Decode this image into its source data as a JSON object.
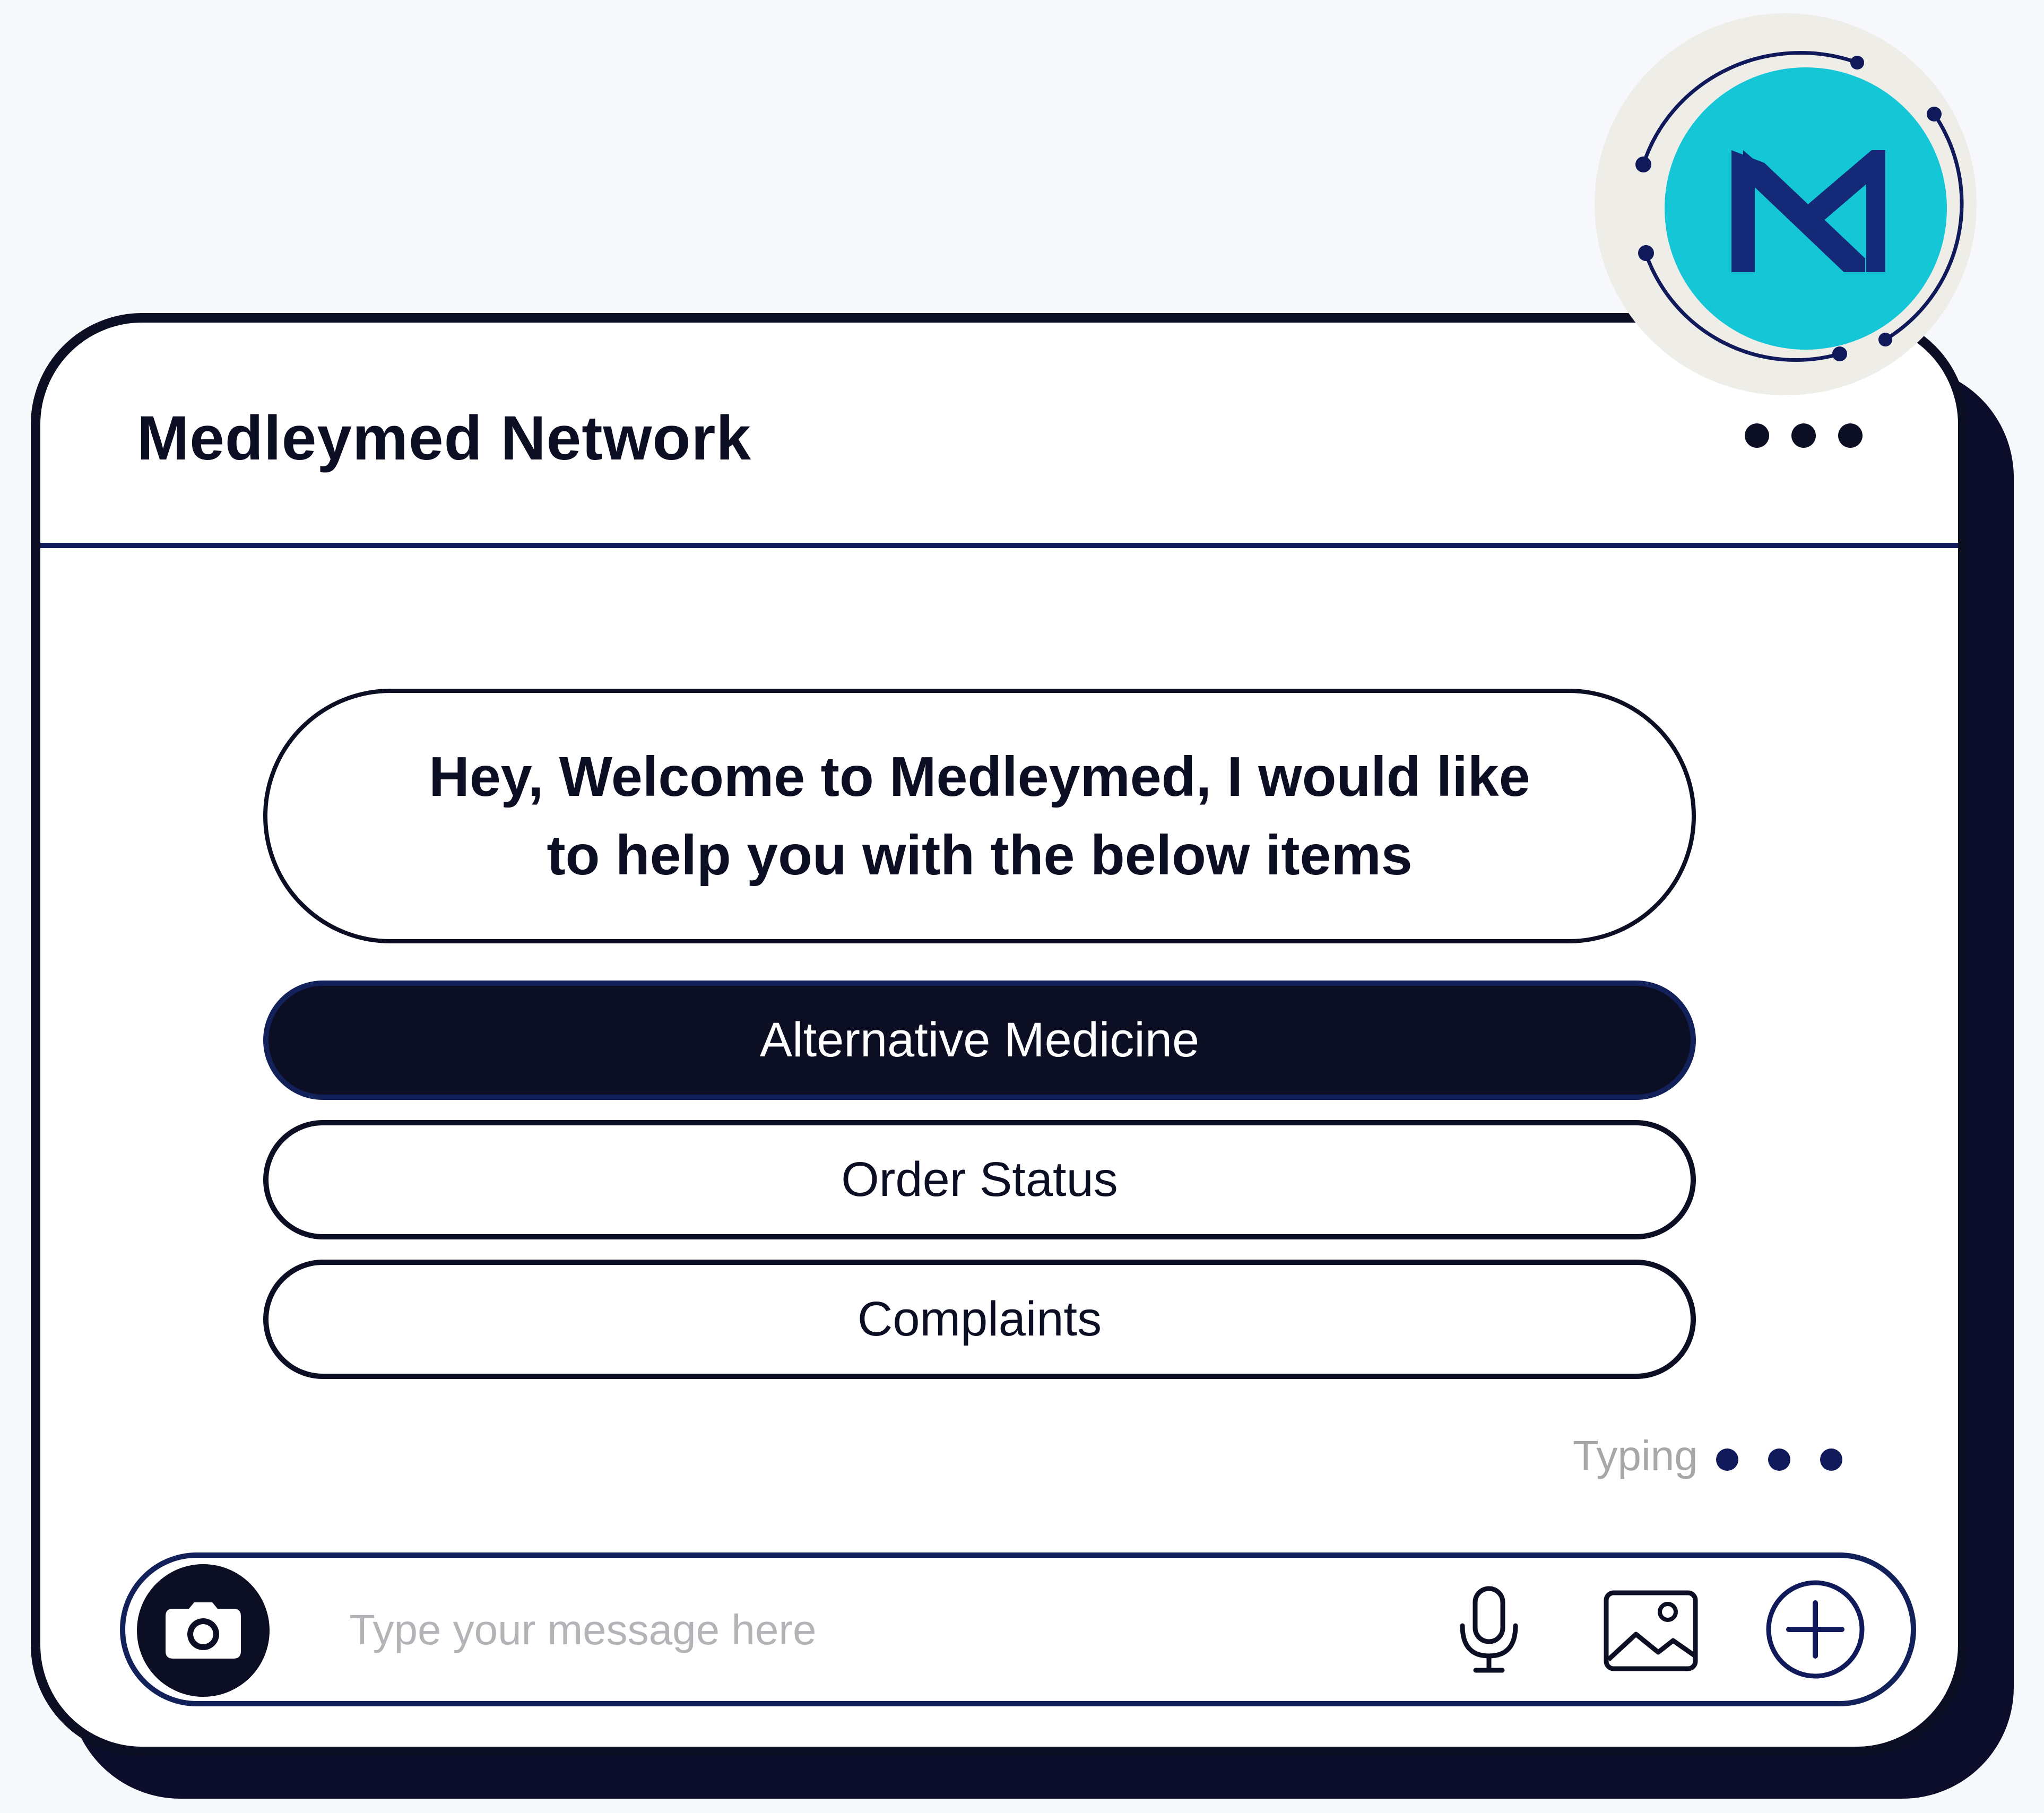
{
  "header": {
    "title": "Medleymed Network"
  },
  "chat": {
    "welcome_message": "Hey, Welcome to Medleymed, I would like to help you with the below items",
    "options": [
      {
        "label": "Alternative Medicine",
        "selected": true
      },
      {
        "label": "Order Status",
        "selected": false
      },
      {
        "label": "Complaints",
        "selected": false
      }
    ],
    "typing_label": "Typing"
  },
  "composer": {
    "placeholder": "Type your message here",
    "value": ""
  },
  "icons": {
    "logo": "medleymed-m-logo-icon",
    "menu": "more-dots-icon",
    "camera": "camera-icon",
    "microphone": "microphone-icon",
    "image": "image-icon",
    "add": "plus-circle-icon"
  },
  "colors": {
    "navy": "#0c0e24",
    "accent_blue": "#101a5a",
    "logo_teal": "#14c6d6",
    "logo_bg": "#efede8"
  }
}
